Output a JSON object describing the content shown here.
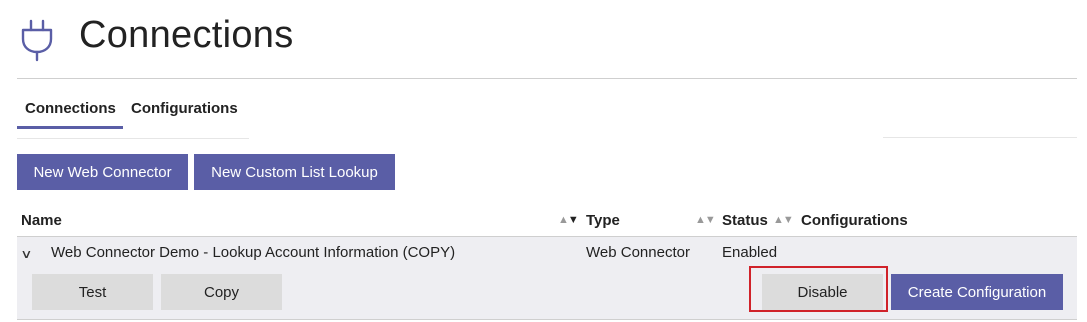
{
  "header": {
    "title": "Connections",
    "icon": "plug-icon",
    "icon_color": "#5a5ea6"
  },
  "tabs": [
    {
      "label": "Connections",
      "active": true
    },
    {
      "label": "Configurations",
      "active": false
    }
  ],
  "toolbar": {
    "new_web_connector_label": "New Web Connector",
    "new_custom_list_lookup_label": "New Custom List Lookup"
  },
  "table": {
    "columns": {
      "name": "Name",
      "type": "Type",
      "status": "Status",
      "configurations": "Configurations"
    },
    "rows": [
      {
        "name": "Web Connector Demo - Lookup Account Information (COPY)",
        "type": "Web Connector",
        "status": "Enabled",
        "expanded": true,
        "actions": {
          "test_label": "Test",
          "copy_label": "Copy",
          "disable_label": "Disable",
          "create_configuration_label": "Create Configuration"
        }
      }
    ]
  },
  "colors": {
    "accent": "#5a5ea6",
    "row_background": "#eeeef2",
    "secondary_button": "#dcdcdc",
    "highlight": "#d0222a"
  }
}
